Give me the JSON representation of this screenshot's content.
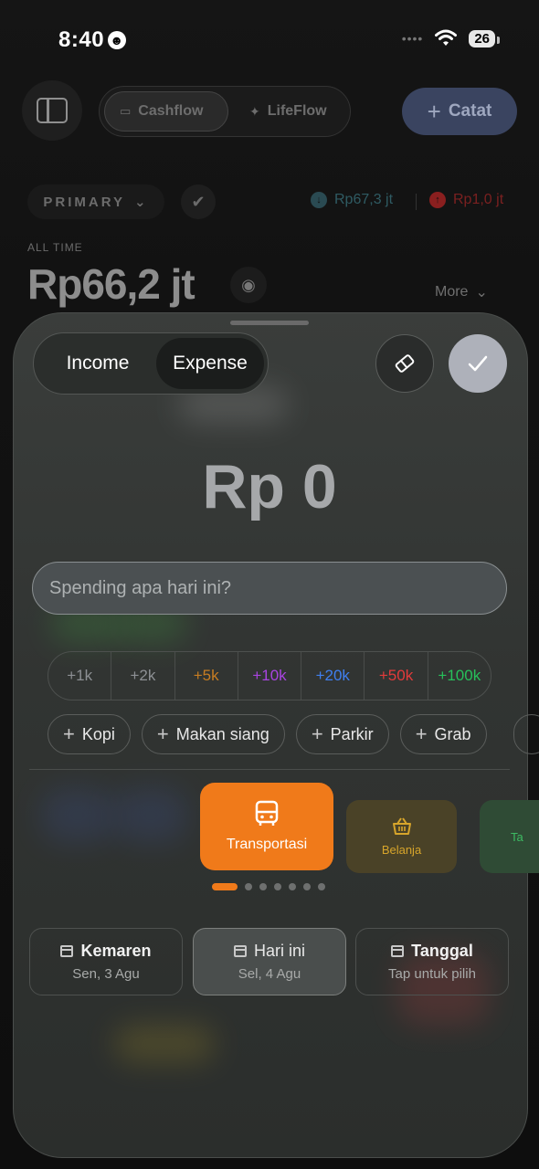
{
  "status_bar": {
    "time": "8:40",
    "battery": "26"
  },
  "header": {
    "tabs": [
      {
        "label": "Cashflow",
        "active": true
      },
      {
        "label": "LifeFlow",
        "active": false
      }
    ],
    "catat_label": "Catat"
  },
  "account": {
    "name": "PRIMARY",
    "income_total": "Rp67,3 jt",
    "expense_total": "Rp1,0 jt",
    "period_label": "ALL TIME",
    "balance": "Rp66,2 jt",
    "more_label": "More"
  },
  "sheet": {
    "type_options": [
      {
        "label": "Income",
        "active": false
      },
      {
        "label": "Expense",
        "active": true
      }
    ],
    "amount": "Rp 0",
    "note_placeholder": "Spending apa hari ini?",
    "quick_amounts": [
      {
        "label": "+1k",
        "color": "#8d9094"
      },
      {
        "label": "+2k",
        "color": "#8d9094"
      },
      {
        "label": "+5k",
        "color": "#c77d22"
      },
      {
        "label": "+10k",
        "color": "#a944e0"
      },
      {
        "label": "+20k",
        "color": "#3f7ff0"
      },
      {
        "label": "+50k",
        "color": "#e23b3b"
      },
      {
        "label": "+100k",
        "color": "#27c05a"
      }
    ],
    "chips": [
      "Kopi",
      "Makan siang",
      "Parkir",
      "Grab"
    ],
    "categories": [
      {
        "label": "Transportasi",
        "icon": "bus-icon",
        "color": "#f07a1a",
        "selected": true
      },
      {
        "label": "Belanja",
        "icon": "basket-icon",
        "color": "#d7a52b",
        "selected": false
      },
      {
        "label": "Ta",
        "icon": "",
        "color": "#3dbb63",
        "selected": false
      }
    ],
    "page_count": 7,
    "active_page": 0,
    "dates": [
      {
        "title": "Kemaren",
        "sub": "Sen, 3 Agu",
        "selected": false
      },
      {
        "title": "Hari ini",
        "sub": "Sel, 4 Agu",
        "selected": true
      },
      {
        "title": "Tanggal",
        "sub": "Tap untuk pilih",
        "selected": false
      }
    ]
  }
}
